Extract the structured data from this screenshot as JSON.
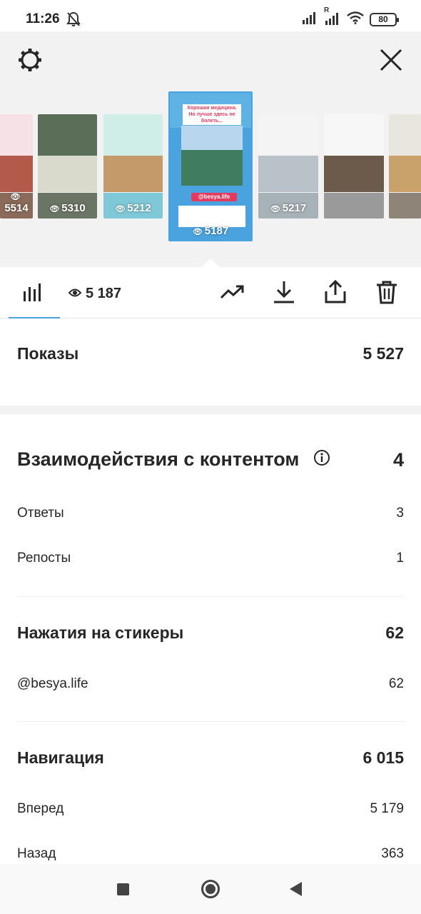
{
  "status_bar": {
    "time": "11:26",
    "battery": "80",
    "roaming": "R"
  },
  "stories": [
    {
      "views": "5514"
    },
    {
      "views": "5310"
    },
    {
      "views": "5212"
    },
    {
      "views": "5187",
      "selected": true,
      "sticker": "@besya.life",
      "headline": "Хорошая медицина. Но лучше здесь не болеть..."
    },
    {
      "views": "5217"
    },
    {
      "views": ""
    },
    {
      "views": ""
    }
  ],
  "toolbar": {
    "views_count": "5 187",
    "accent_color": "#4aa3df"
  },
  "impressions": {
    "label": "Показы",
    "value": "5 527"
  },
  "interactions": {
    "label": "Взаимодействия с контентом",
    "value": "4",
    "items": [
      {
        "label": "Ответы",
        "value": "3"
      },
      {
        "label": "Репосты",
        "value": "1"
      }
    ]
  },
  "sticker_taps": {
    "label": "Нажатия на стикеры",
    "value": "62",
    "items": [
      {
        "label": "@besya.life",
        "value": "62"
      }
    ]
  },
  "navigation": {
    "label": "Навигация",
    "value": "6 015",
    "items": [
      {
        "label": "Вперед",
        "value": "5 179"
      },
      {
        "label": "Назад",
        "value": "363"
      }
    ]
  }
}
